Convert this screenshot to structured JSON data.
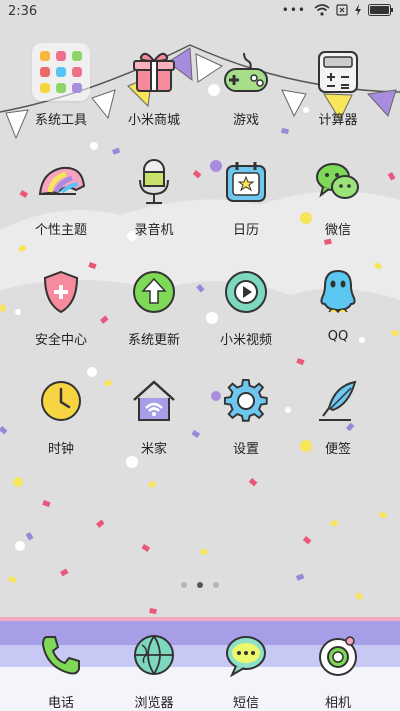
{
  "status_bar": {
    "time": "2:36",
    "dots": "•••"
  },
  "apps": [
    {
      "label": "系统工具",
      "icon": "folder-icon"
    },
    {
      "label": "小米商城",
      "icon": "gift-box-icon"
    },
    {
      "label": "游戏",
      "icon": "gamepad-icon"
    },
    {
      "label": "计算器",
      "icon": "calculator-icon"
    },
    {
      "label": "个性主题",
      "icon": "shell-theme-icon"
    },
    {
      "label": "录音机",
      "icon": "microphone-icon"
    },
    {
      "label": "日历",
      "icon": "calendar-icon"
    },
    {
      "label": "微信",
      "icon": "wechat-icon"
    },
    {
      "label": "安全中心",
      "icon": "shield-icon"
    },
    {
      "label": "系统更新",
      "icon": "update-arrow-icon"
    },
    {
      "label": "小米视频",
      "icon": "video-play-icon"
    },
    {
      "label": "QQ",
      "icon": "qq-penguin-icon"
    },
    {
      "label": "时钟",
      "icon": "clock-icon"
    },
    {
      "label": "米家",
      "icon": "smart-home-icon"
    },
    {
      "label": "设置",
      "icon": "gear-icon"
    },
    {
      "label": "便签",
      "icon": "feather-note-icon"
    }
  ],
  "dock": [
    {
      "label": "电话",
      "icon": "phone-icon"
    },
    {
      "label": "浏览器",
      "icon": "globe-browser-icon"
    },
    {
      "label": "短信",
      "icon": "message-bubble-icon"
    },
    {
      "label": "相机",
      "icon": "camera-icon"
    }
  ],
  "pages": {
    "count": 3,
    "current": 2
  },
  "colors": {
    "background": "#dedede",
    "dock_stripe_pink": "#f5a7c0",
    "dock_stripe_purple": "#a79ee8",
    "dock_stripe_blue": "#c8c8f5",
    "flag_purple": "#a98be0",
    "flag_yellow": "#f7e55a",
    "flag_white": "#ffffff"
  }
}
